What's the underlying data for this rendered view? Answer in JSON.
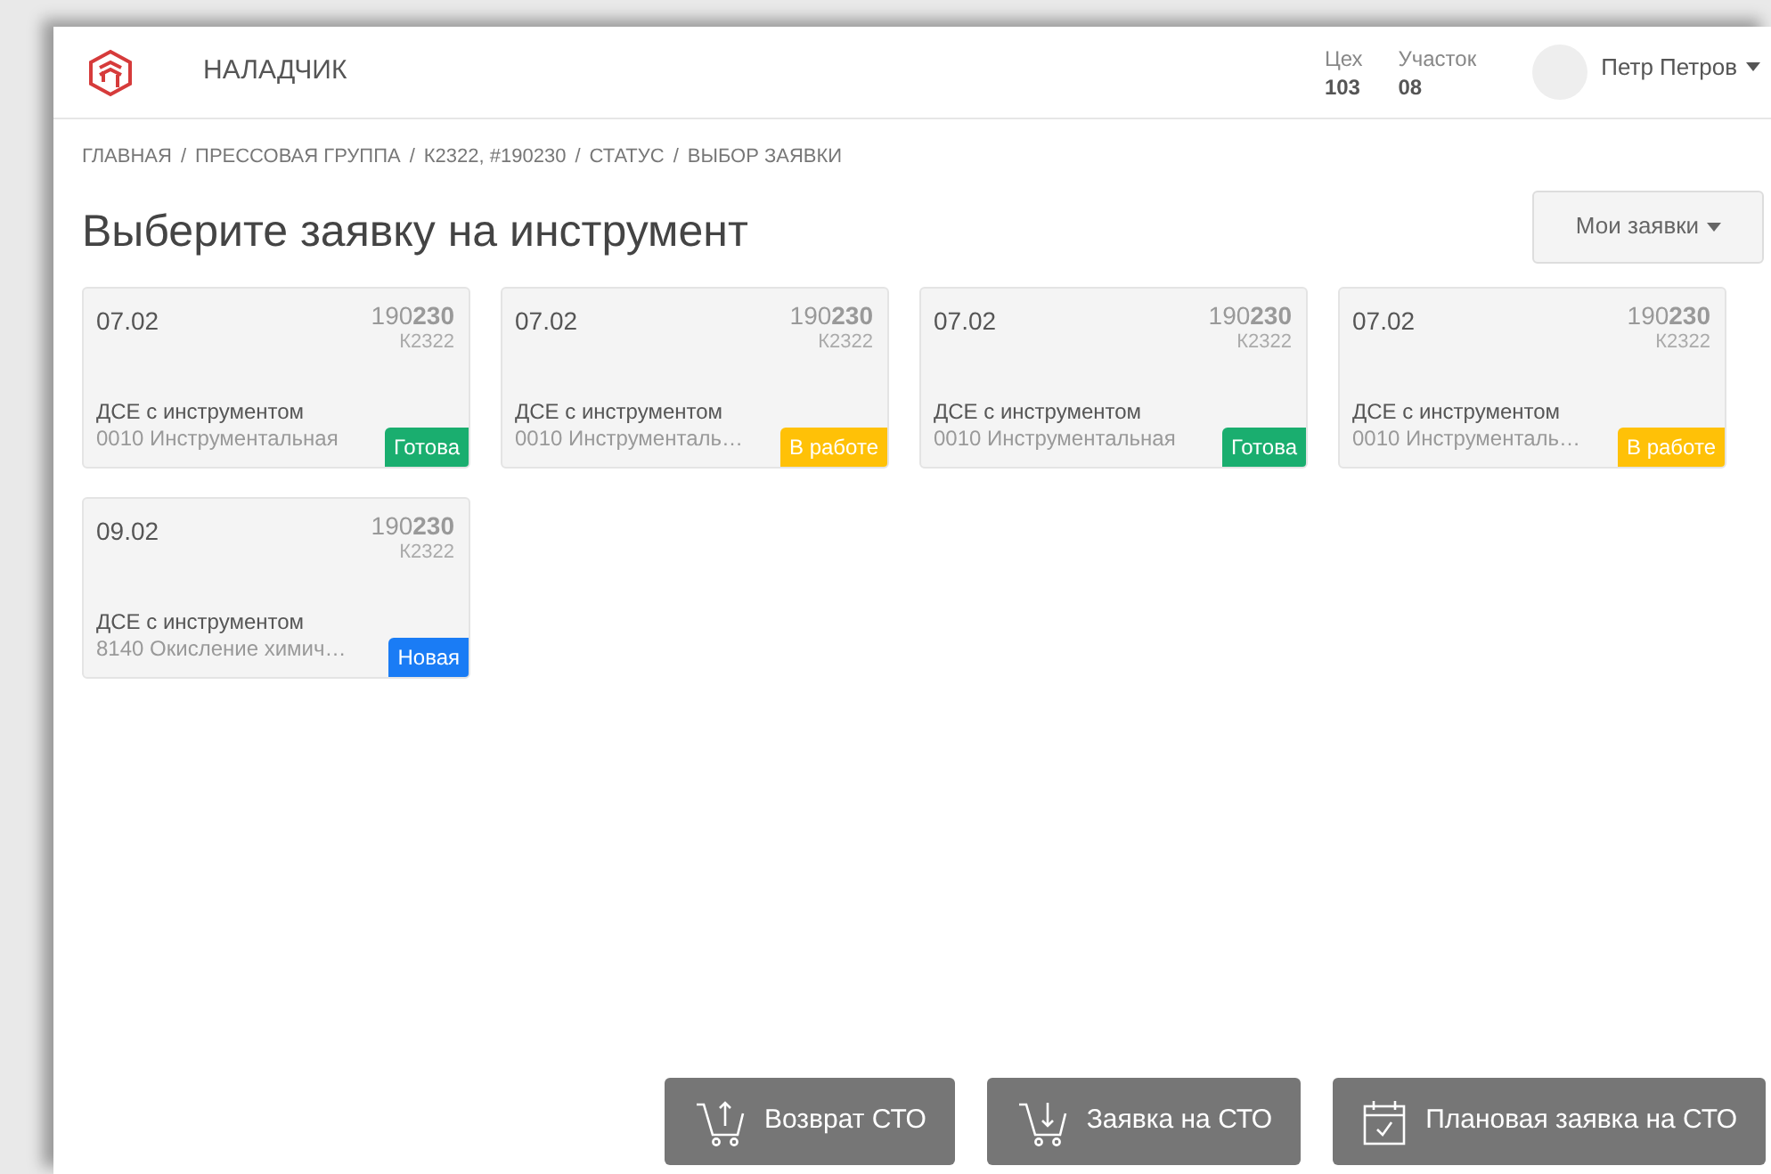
{
  "header": {
    "app_title": "НАЛАДЧИК",
    "workshop": {
      "label": "Цех",
      "value": "103"
    },
    "section": {
      "label": "Участок",
      "value": "08"
    },
    "user": {
      "name": "Петр Петров"
    }
  },
  "breadcrumbs": [
    {
      "label": "ГЛАВНАЯ"
    },
    {
      "separator": "/",
      "label": "ПРЕССОВАЯ ГРУППА"
    },
    {
      "separator": "/",
      "label": "К2322, #190230"
    },
    {
      "separator": "/",
      "label": "СТАТУС"
    },
    {
      "separator": "/",
      "label": "ВЫБОР ЗАЯВКИ"
    }
  ],
  "page_title": "Выберите заявку на инструмент",
  "my_requests_button": "Мои заявки",
  "cards": [
    {
      "date": "07.02",
      "number": "190**230**",
      "code": "К2322",
      "title": "ДСЕ с инструментом",
      "operation": "0010 Инструментальная",
      "status": "Готова",
      "kind": "ready"
    },
    {
      "date": "07.02",
      "number": "190**230**",
      "code": "К2322",
      "title": "ДСЕ с инструментом",
      "operation": "0010 Инструменталь…",
      "status": "В работе",
      "kind": "in_progress"
    },
    {
      "date": "07.02",
      "number": "190**230**",
      "code": "К2322",
      "title": "ДСЕ с инструментом",
      "operation": "0010 Инструментальная",
      "status": "Готова",
      "kind": "ready"
    },
    {
      "date": "07.02",
      "number": "190**230**",
      "code": "К2322",
      "title": "ДСЕ с инструментом",
      "operation": "0010 Инструменталь…",
      "status": "В работе",
      "kind": "in_progress"
    },
    {
      "date": "09.02",
      "number": "190**230**",
      "code": "К2322",
      "title": "ДСЕ с инструментом",
      "operation": "8140 Окисление химич…",
      "status": "Новая",
      "kind": "new"
    }
  ],
  "actions": [
    {
      "label": "Возврат СТО",
      "kind": "return"
    },
    {
      "label": "Заявка на СТО",
      "kind": "request"
    },
    {
      "label": "Плановая заявка на СТО",
      "kind": "planned"
    }
  ]
}
